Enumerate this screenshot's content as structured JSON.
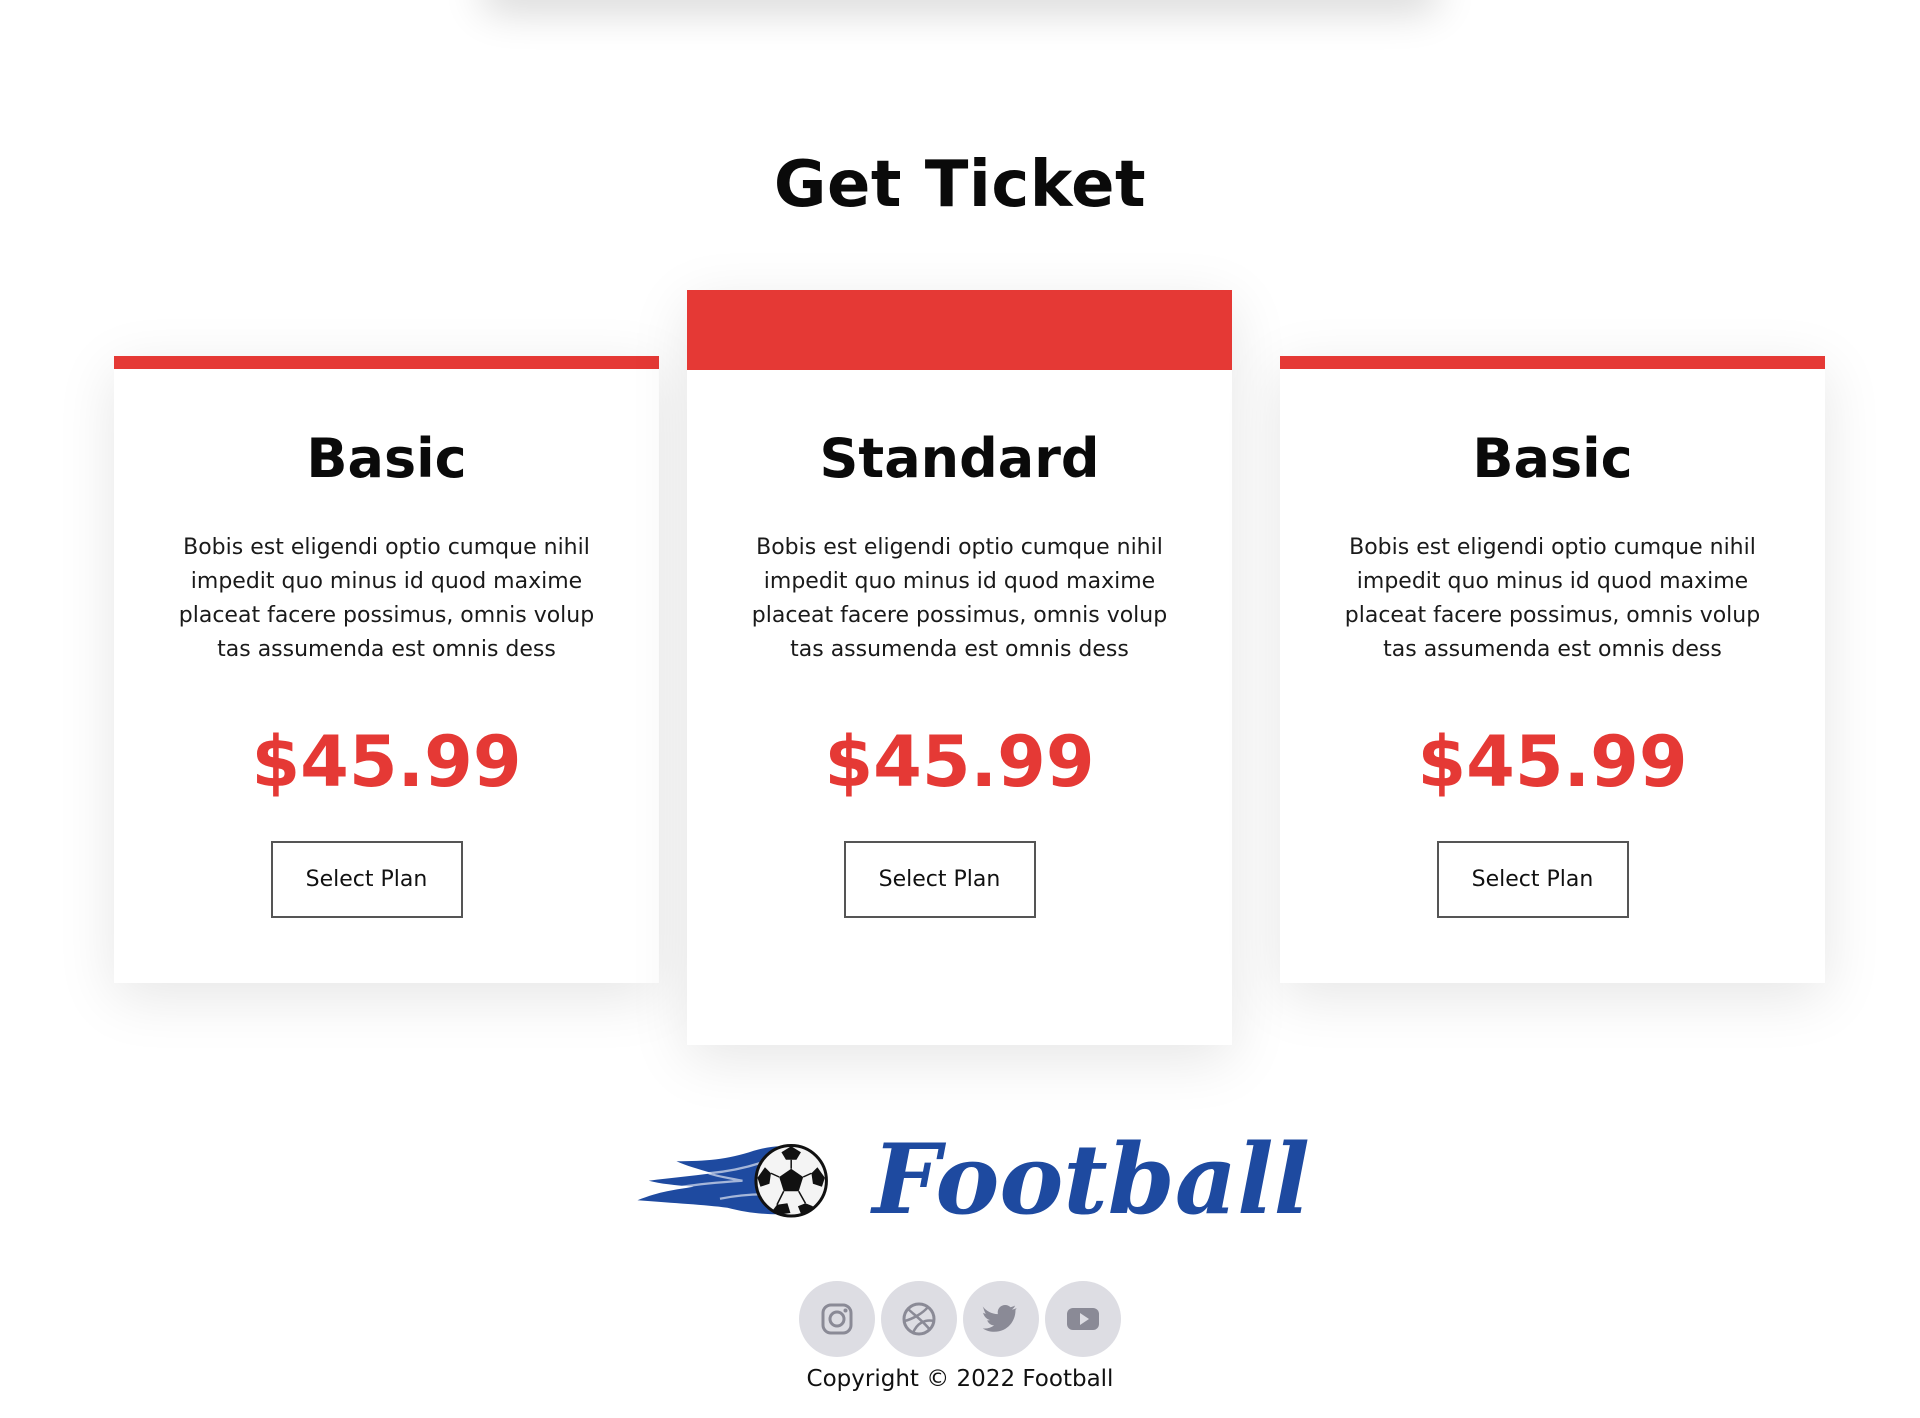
{
  "section": {
    "title": "Get Ticket"
  },
  "plans": [
    {
      "title": "Basic",
      "description": "Bobis est eligendi optio cumque nihil impedit quo minus id quod maxime placeat facere possimus, omnis volup tas assumenda est omnis dess",
      "price": "$45.99",
      "button_label": "Select Plan"
    },
    {
      "title": "Standard",
      "description": "Bobis est eligendi optio cumque nihil impedit quo minus id quod maxime placeat facere possimus, omnis volup tas assumenda est omnis dess",
      "price": "$45.99",
      "button_label": "Select Plan"
    },
    {
      "title": "Basic",
      "description": "Bobis est eligendi optio cumque nihil impedit quo minus id quod maxime placeat facere possimus, omnis volup tas assumenda est omnis dess",
      "price": "$45.99",
      "button_label": "Select Plan"
    }
  ],
  "footer": {
    "logo_text": "Football",
    "social": [
      "instagram-icon",
      "dribbble-icon",
      "twitter-icon",
      "youtube-icon"
    ],
    "copyright": "Copyright © 2022 Football"
  },
  "colors": {
    "accent": "#e53935",
    "logo_blue": "#1e4aa0",
    "social_bg": "#dddde3",
    "social_icon": "#8a8a96"
  }
}
